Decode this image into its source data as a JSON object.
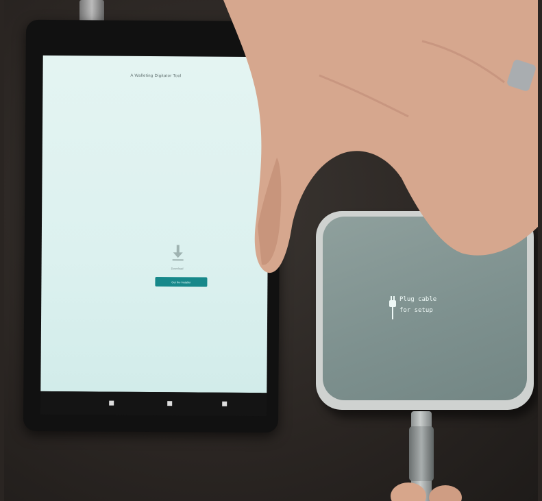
{
  "tablet": {
    "screen_title": "A Walleting Digitator Tool",
    "download_caption": "Download",
    "button_label": "Get the Installer",
    "icons": {
      "download": "download-arrow-icon",
      "fab": "fab-circle-icon",
      "nav": [
        "back-icon",
        "home-icon",
        "recents-icon"
      ]
    },
    "colors": {
      "screen_bg": "#dff3f1",
      "button_bg": "#17888a",
      "fab_bg": "#1fa3b6"
    }
  },
  "device": {
    "display_line1": "Plug cable",
    "display_line2": "for setup",
    "display_icon": "plug-icon",
    "colors": {
      "body": "#cfd2d0",
      "top": "#84958f",
      "text": "#eef8f6"
    }
  }
}
